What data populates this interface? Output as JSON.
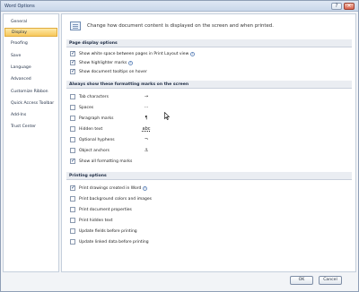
{
  "window": {
    "title": "Word Options",
    "help_symbol": "?",
    "close_symbol": "×"
  },
  "sidebar": {
    "items": [
      {
        "label": "General"
      },
      {
        "label": "Display",
        "active": true
      },
      {
        "label": "Proofing"
      },
      {
        "label": "Save"
      },
      {
        "label": "Language"
      },
      {
        "label": "Advanced"
      },
      {
        "label": "Customize Ribbon"
      },
      {
        "label": "Quick Access Toolbar"
      },
      {
        "label": "Add-Ins"
      },
      {
        "label": "Trust Center"
      }
    ]
  },
  "header": {
    "text": "Change how document content is displayed on the screen and when printed."
  },
  "sections": {
    "page_display": {
      "title": "Page display options",
      "options": [
        {
          "label": "Show white space between pages in Print Layout view",
          "checked": true,
          "info": true
        },
        {
          "label": "Show highlighter marks",
          "checked": true,
          "info": true
        },
        {
          "label": "Show document tooltips on hover",
          "checked": true,
          "info": false
        }
      ]
    },
    "formatting_marks": {
      "title": "Always show these formatting marks on the screen",
      "options": [
        {
          "label": "Tab characters",
          "checked": false,
          "mark": "→"
        },
        {
          "label": "Spaces",
          "checked": false,
          "mark": "···"
        },
        {
          "label": "Paragraph marks",
          "checked": false,
          "mark": "¶"
        },
        {
          "label": "Hidden text",
          "checked": false,
          "mark": "abc"
        },
        {
          "label": "Optional hyphens",
          "checked": false,
          "mark": "¬"
        },
        {
          "label": "Object anchors",
          "checked": false,
          "mark": "⚓"
        },
        {
          "label": "Show all formatting marks",
          "checked": true,
          "mark": ""
        }
      ]
    },
    "printing": {
      "title": "Printing options",
      "options": [
        {
          "label": "Print drawings created in Word",
          "checked": true,
          "info": true
        },
        {
          "label": "Print background colors and images",
          "checked": false
        },
        {
          "label": "Print document properties",
          "checked": false
        },
        {
          "label": "Print hidden text",
          "checked": false
        },
        {
          "label": "Update fields before printing",
          "checked": false
        },
        {
          "label": "Update linked data before printing",
          "checked": false
        }
      ]
    }
  },
  "buttons": {
    "ok": "OK",
    "cancel": "Cancel"
  },
  "colors": {
    "active_nav": "#f7c85b",
    "section_bg": "#eaedf2",
    "checkmark": "#1c3f77"
  }
}
